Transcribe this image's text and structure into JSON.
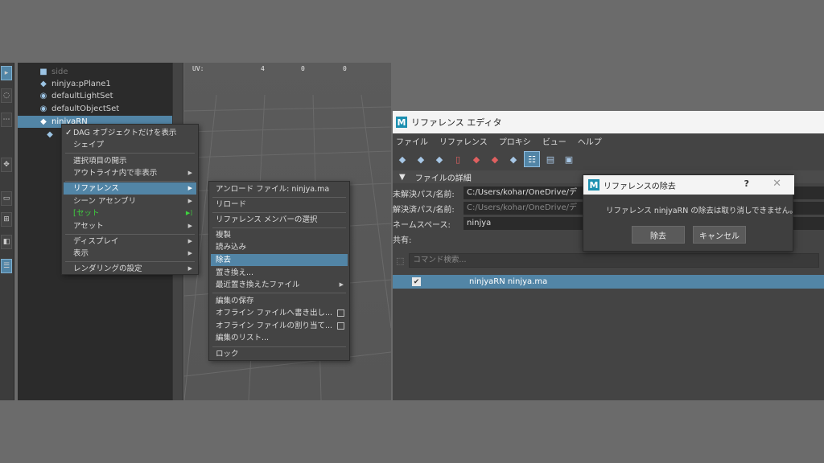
{
  "outliner": {
    "items": [
      {
        "label": "side",
        "icon": "camera-icon"
      },
      {
        "label": "ninjya:pPlane1",
        "icon": "mesh-icon"
      },
      {
        "label": "defaultLightSet",
        "icon": "set-icon"
      },
      {
        "label": "defaultObjectSet",
        "icon": "set-icon"
      },
      {
        "label": "ninjyaRN",
        "icon": "reference-icon"
      }
    ]
  },
  "viewport": {
    "uv_label": "UV:",
    "uv_values": [
      "4",
      "0",
      "0"
    ]
  },
  "context_menu": {
    "items": [
      "DAG オブジェクトだけを表示",
      "シェイプ",
      "選択項目の開示",
      "アウトライナ内で非表示",
      "リファレンス",
      "シーン アセンブリ",
      "セット",
      "アセット",
      "ディスプレイ",
      "表示",
      "レンダリングの設定"
    ]
  },
  "sub_menu": {
    "items": [
      "アンロード ファイル: ninjya.ma",
      "リロード",
      "リファレンス メンバーの選択",
      "複製",
      "読み込み",
      "除去",
      "置き換え...",
      "最近置き換えたファイル",
      "編集の保存",
      "オフライン ファイルへ書き出し...",
      "オフライン ファイルの割り当て...",
      "編集のリスト...",
      "ロック"
    ]
  },
  "ref_editor": {
    "title": "リファレンス エディタ",
    "menus": [
      "ファイル",
      "リファレンス",
      "プロキシ",
      "ビュー",
      "ヘルプ"
    ],
    "section": "ファイルの詳細",
    "unresolved_label": "未解決パス/名前:",
    "unresolved_value": "C:/Users/kohar/OneDrive/デ",
    "resolved_label": "解決済パス/名前:",
    "resolved_value": "C:/Users/kohar/OneDrive/デ",
    "namespace_label": "ネームスペース:",
    "namespace_value": "ninjya",
    "shared_label": "共有:",
    "command_placeholder": "コマンド検索...",
    "row_text": "ninjyaRN  ninjya.ma"
  },
  "dialog": {
    "title": "リファレンスの除去",
    "help": "?",
    "message": "リファレンス ninjyaRN の除去は取り消しできません。",
    "remove_label": "除去",
    "cancel_label": "キャンセル"
  }
}
